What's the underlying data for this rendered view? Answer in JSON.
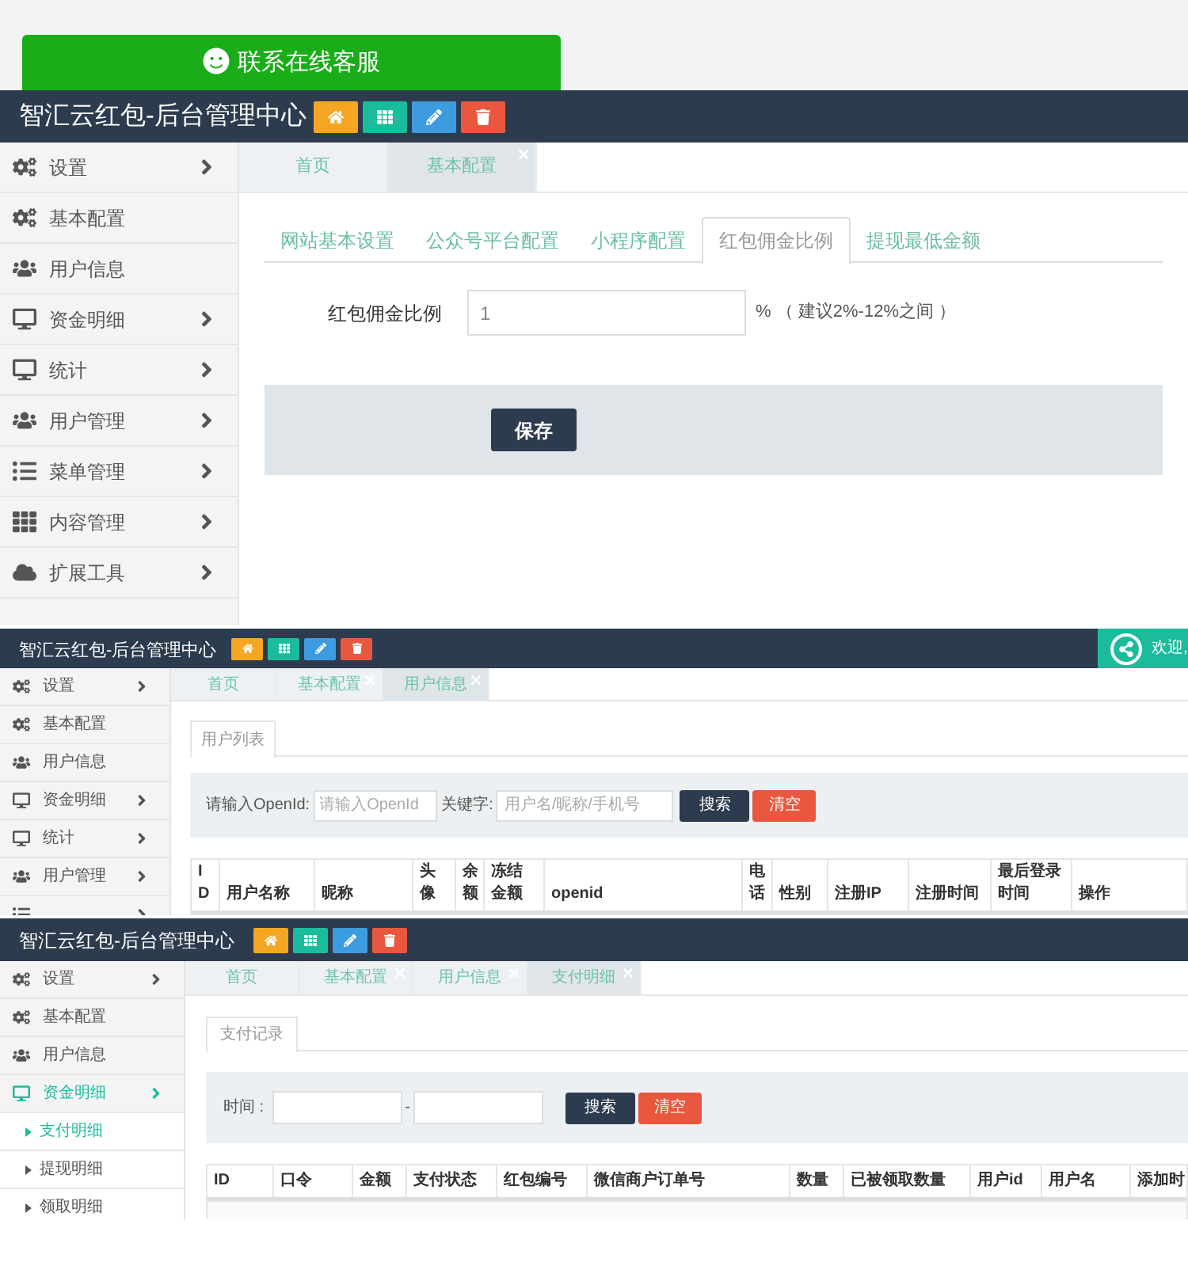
{
  "top": {
    "contact_button": "联系在线客服"
  },
  "screens": [
    {
      "kind": "config",
      "title": "智汇云红包-后台管理中心",
      "tools": [
        {
          "kind": "home",
          "color": "#f5a623"
        },
        {
          "kind": "grid",
          "color": "#1abc9c"
        },
        {
          "kind": "edit",
          "color": "#3d9be0"
        },
        {
          "kind": "delete",
          "color": "#e9573f"
        }
      ],
      "sidebar": [
        {
          "label": "设置",
          "kind": "cogs",
          "arrow": true,
          "selected": false
        },
        {
          "label": "基本配置",
          "kind": "cogs",
          "arrow": false,
          "selected": false
        },
        {
          "label": "用户信息",
          "kind": "users",
          "arrow": false,
          "selected": false
        },
        {
          "label": "资金明细",
          "kind": "desktop",
          "arrow": true,
          "selected": false
        },
        {
          "label": "统计",
          "kind": "desktop",
          "arrow": true,
          "selected": false
        },
        {
          "label": "用户管理",
          "kind": "users",
          "arrow": true,
          "selected": false
        },
        {
          "label": "菜单管理",
          "kind": "list",
          "arrow": true,
          "selected": false
        },
        {
          "label": "内容管理",
          "kind": "apps",
          "arrow": true,
          "selected": false
        },
        {
          "label": "扩展工具",
          "kind": "cloud",
          "arrow": true,
          "selected": false
        }
      ],
      "page_tabs": [
        {
          "label": "首页",
          "closable": false,
          "selected": false
        },
        {
          "label": "基本配置",
          "closable": true,
          "selected": true
        }
      ],
      "config_tabs": [
        {
          "label": "网站基本设置",
          "selected": false
        },
        {
          "label": "公众号平台配置",
          "selected": false
        },
        {
          "label": "小程序配置",
          "selected": false
        },
        {
          "label": "红包佣金比例",
          "selected": true
        },
        {
          "label": "提现最低金额",
          "selected": false
        }
      ],
      "form": {
        "label": "红包佣金比例",
        "value": "1",
        "hint": "% （ 建议2%-12%之间 ）"
      },
      "save_button": "保存"
    },
    {
      "kind": "user_list",
      "title": "智汇云红包-后台管理中心",
      "welcome": "欢迎,",
      "tools": [
        {
          "kind": "home",
          "color": "#f5a623"
        },
        {
          "kind": "grid",
          "color": "#1abc9c"
        },
        {
          "kind": "edit",
          "color": "#3d9be0"
        },
        {
          "kind": "delete",
          "color": "#e9573f"
        }
      ],
      "sidebar": [
        {
          "label": "设置",
          "kind": "cogs",
          "arrow": true,
          "selected": false
        },
        {
          "label": "基本配置",
          "kind": "cogs",
          "arrow": false,
          "selected": false
        },
        {
          "label": "用户信息",
          "kind": "users",
          "arrow": false,
          "selected": false
        },
        {
          "label": "资金明细",
          "kind": "desktop",
          "arrow": true,
          "selected": false
        },
        {
          "label": "统计",
          "kind": "desktop",
          "arrow": true,
          "selected": false
        },
        {
          "label": "用户管理",
          "kind": "users",
          "arrow": true,
          "selected": false
        },
        {
          "kind": "list",
          "arrow": true,
          "selected": false
        }
      ],
      "page_tabs": [
        {
          "label": "首页",
          "closable": false,
          "selected": false
        },
        {
          "label": "基本配置",
          "closable": true,
          "selected": false
        },
        {
          "label": "用户信息",
          "closable": true,
          "selected": true
        }
      ],
      "inner_tab": "用户列表",
      "search": {
        "openid_label": "请输入OpenId:",
        "openid_placeholder": "请输入OpenId",
        "keyword_label": "关键字:",
        "keyword_placeholder": "用户名/昵称/手机号",
        "search_button": "搜索",
        "clear_button": "清空"
      },
      "table": {
        "columns": [
          "ID",
          "用户名称",
          "昵称",
          "头像",
          "余额",
          "冻结金额",
          "openid",
          "电话",
          "性别",
          "注册IP",
          "注册时间",
          "最后登录时间",
          "操作"
        ]
      }
    },
    {
      "kind": "payment_list",
      "title": "智汇云红包-后台管理中心",
      "tools": [
        {
          "kind": "home",
          "color": "#f5a623"
        },
        {
          "kind": "grid",
          "color": "#1abc9c"
        },
        {
          "kind": "edit",
          "color": "#3d9be0"
        },
        {
          "kind": "delete",
          "color": "#e9573f"
        }
      ],
      "sidebar": [
        {
          "label": "设置",
          "kind": "cogs",
          "arrow": true,
          "selected": false
        },
        {
          "label": "基本配置",
          "kind": "cogs",
          "arrow": false,
          "selected": false
        },
        {
          "label": "用户信息",
          "kind": "users",
          "arrow": false,
          "selected": false
        },
        {
          "label": "资金明细",
          "kind": "desktop",
          "arrow": true,
          "selected": true,
          "children": [
            {
              "label": "支付明细",
              "selected": true
            },
            {
              "label": "提现明细",
              "selected": false
            },
            {
              "label": "领取明细",
              "selected": false
            }
          ]
        }
      ],
      "page_tabs": [
        {
          "label": "首页",
          "closable": false,
          "selected": false
        },
        {
          "label": "基本配置",
          "closable": true,
          "selected": false
        },
        {
          "label": "用户信息",
          "closable": true,
          "selected": false
        },
        {
          "label": "支付明细",
          "closable": true,
          "selected": true
        }
      ],
      "inner_tab": "支付记录",
      "search": {
        "time_label": "时间 :",
        "separator": "-",
        "search_button": "搜索",
        "clear_button": "清空"
      },
      "table": {
        "columns": [
          "ID",
          "口令",
          "金额",
          "支付状态",
          "红包编号",
          "微信商户订单号",
          "数量",
          "已被领取数量",
          "用户id",
          "用户名",
          "添加时"
        ]
      }
    }
  ]
}
